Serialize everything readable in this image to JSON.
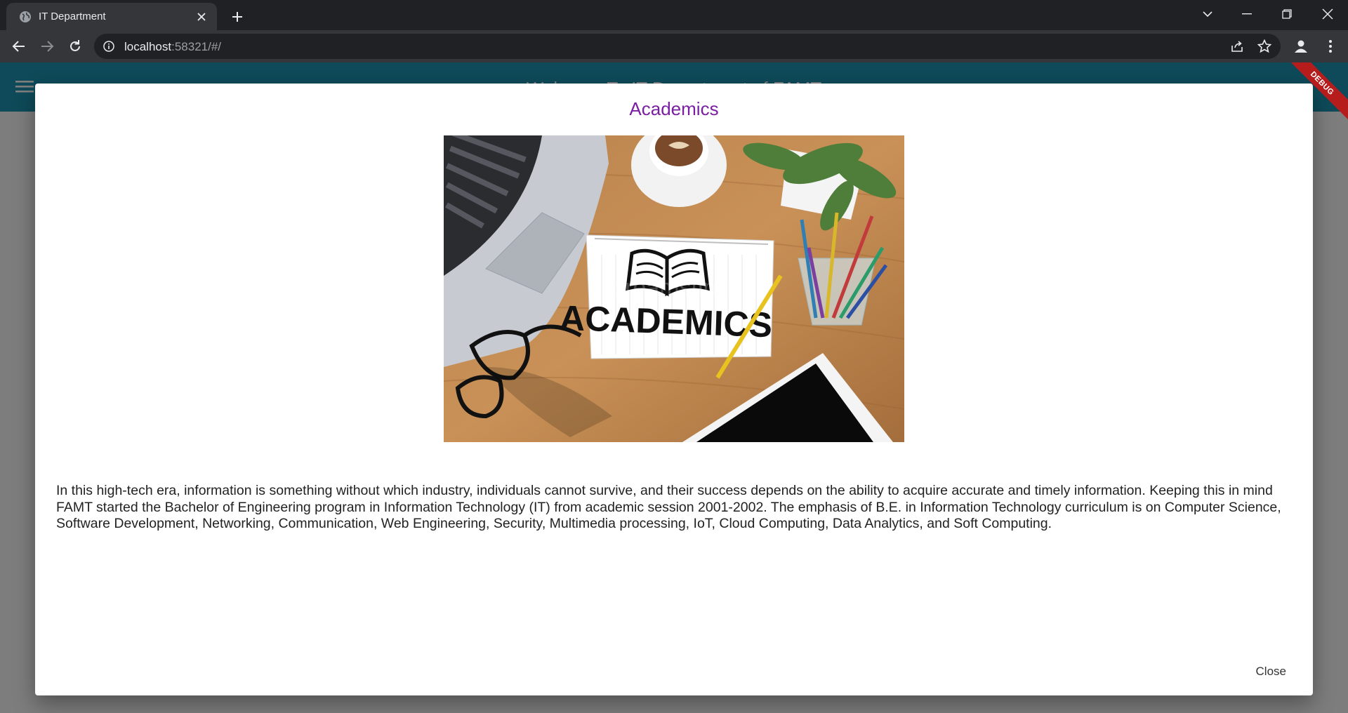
{
  "browser": {
    "tab_title": "IT Department",
    "url_host": "localhost",
    "url_rest": ":58321/#/"
  },
  "app": {
    "title": "Welcome To IT Department of FAMT",
    "debug_label": "DEBUG",
    "colors": {
      "appbar": "#1c95b3",
      "dialog_title": "#7b1fa2"
    }
  },
  "dialog": {
    "title": "Academics",
    "image_text": "ACADEMICS",
    "body": "In this high-tech era, information is something without which industry, individuals cannot survive, and their success depends on the ability to acquire accurate and timely information. Keeping this in mind FAMT started the Bachelor of Engineering program in Information Technology (IT) from academic session 2001-2002. The emphasis of B.E. in Information Technology curriculum is on Computer Science, Software Development, Networking, Communication, Web Engineering, Security, Multimedia processing, IoT, Cloud Computing, Data Analytics, and Soft Computing.",
    "close_label": "Close"
  }
}
